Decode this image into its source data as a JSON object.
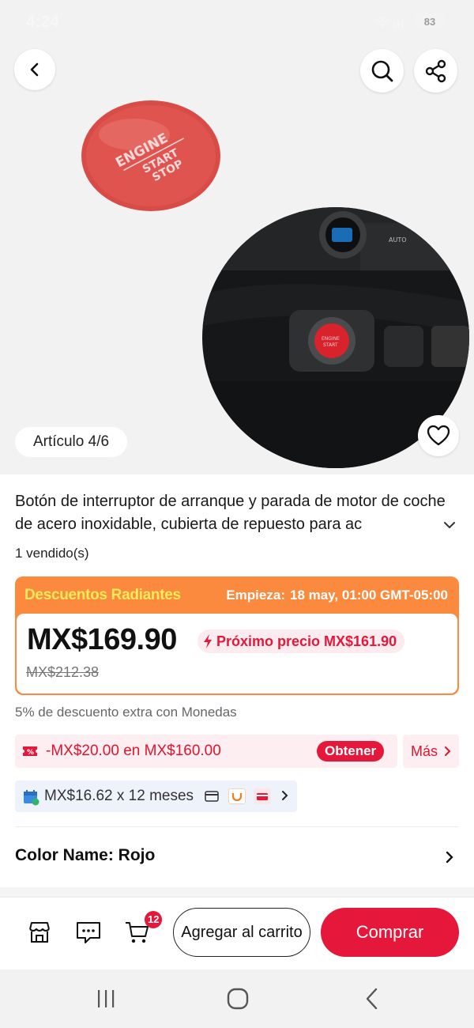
{
  "status_bar": {
    "time": "4:24",
    "battery": "83"
  },
  "gallery": {
    "counter": "Artículo 4/6"
  },
  "product": {
    "title": "Botón de interruptor de arranque y parada de motor de coche de acero inoxidable, cubierta de repuesto para ac",
    "sold": "1 vendido(s)"
  },
  "promo": {
    "name": "Descuentos Radiantes",
    "starts_label": "Empieza:",
    "starts_value": "18 may, 01:00 GMT-05:00",
    "price": "MX$169.90",
    "next_price": "Próximo precio MX$161.90",
    "original_price": "MX$212.38"
  },
  "coins_text": "5% de descuento extra con Monedas",
  "coupon": {
    "text": "-MX$20.00 en MX$160.00",
    "get_label": "Obtener",
    "more_label": "Más"
  },
  "installment": {
    "text": "MX$16.62 x 12 meses"
  },
  "color": {
    "label": "Color Name: Rojo"
  },
  "actions": {
    "cart_count": "12",
    "add_to_cart": "Agregar al carrito",
    "buy": "Comprar"
  },
  "colors": {
    "accent": "#e5173b",
    "promo_orange": "#fb8a3e",
    "promo_yellow": "#f9ea5a"
  }
}
